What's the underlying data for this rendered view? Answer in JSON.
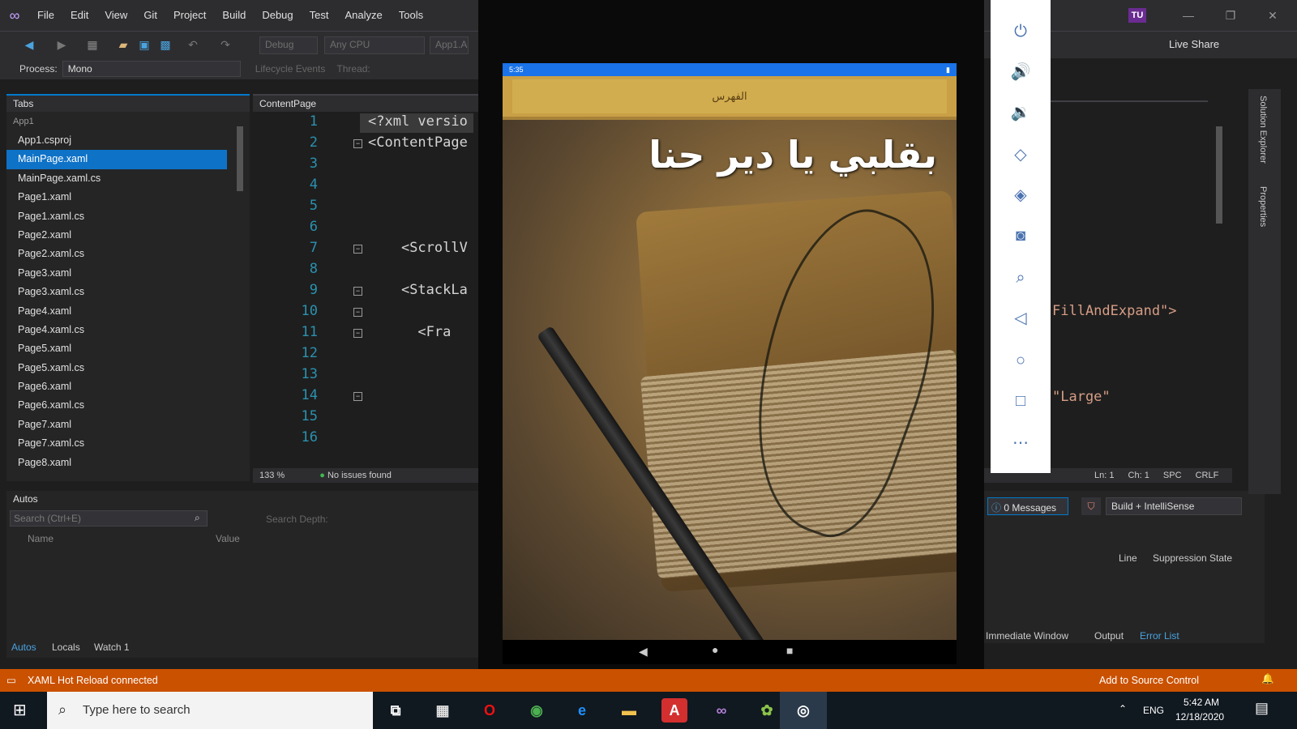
{
  "menu": {
    "items": [
      "File",
      "Edit",
      "View",
      "Git",
      "Project",
      "Build",
      "Debug",
      "Test",
      "Analyze",
      "Tools"
    ],
    "user_initials": "TU",
    "live_share": "Live Share"
  },
  "toolbar": {
    "config": "Debug",
    "platform": "Any CPU",
    "project_dd": "App1.A",
    "process_label": "Process:",
    "process_value": "Mono",
    "lifecycle": "Lifecycle Events",
    "thread": "Thread:"
  },
  "tabs_panel": {
    "title": "Tabs",
    "group": "App1",
    "files": [
      "App1.csproj",
      "MainPage.xaml",
      "MainPage.xaml.cs",
      "Page1.xaml",
      "Page1.xaml.cs",
      "Page2.xaml",
      "Page2.xaml.cs",
      "Page3.xaml",
      "Page3.xaml.cs",
      "Page4.xaml",
      "Page4.xaml.cs",
      "Page5.xaml",
      "Page5.xaml.cs",
      "Page6.xaml",
      "Page6.xaml.cs",
      "Page7.xaml",
      "Page7.xaml.cs",
      "Page8.xaml"
    ],
    "selected_index": 1
  },
  "code_panel": {
    "title": "ContentPage",
    "lines": [
      {
        "num": "1",
        "text": "<?xml versio"
      },
      {
        "num": "2",
        "text": "<ContentPage"
      },
      {
        "num": "3",
        "text": ""
      },
      {
        "num": "4",
        "text": ""
      },
      {
        "num": "5",
        "text": ""
      },
      {
        "num": "6",
        "text": ""
      },
      {
        "num": "7",
        "text": "    <ScrollV"
      },
      {
        "num": "8",
        "text": ""
      },
      {
        "num": "9",
        "text": "    <StackLa"
      },
      {
        "num": "10",
        "text": ""
      },
      {
        "num": "11",
        "text": "      <Fra"
      },
      {
        "num": "12",
        "text": ""
      },
      {
        "num": "13",
        "text": ""
      },
      {
        "num": "14",
        "text": ""
      },
      {
        "num": "15",
        "text": ""
      },
      {
        "num": "16",
        "text": ""
      }
    ],
    "zoom": "133 %",
    "issues": "No issues found"
  },
  "autos": {
    "title": "Autos",
    "search_placeholder": "Search (Ctrl+E)",
    "search_depth": "Search Depth:",
    "col_name": "Name",
    "col_value": "Value",
    "tabs": [
      "Autos",
      "Locals",
      "Watch 1"
    ]
  },
  "right_ide": {
    "code1": "FillAndExpand\">",
    "code2": "\"Large\"",
    "ln": "Ln: 1",
    "ch": "Ch: 1",
    "spc": "SPC",
    "crlf": "CRLF",
    "messages": "0 Messages",
    "build_filter": "Build + IntelliSense",
    "col_line": "Line",
    "col_suppression": "Suppression State",
    "bottom_tabs": [
      "Immediate Window",
      "Output",
      "Error List"
    ],
    "side_tabs": [
      "Solution Explorer",
      "Properties"
    ]
  },
  "statusbar": {
    "hot_reload": "XAML Hot Reload connected",
    "source_control": "Add to Source Control"
  },
  "taskbar": {
    "search_placeholder": "Type here to search",
    "lang": "ENG",
    "time": "5:42 AM",
    "date": "12/18/2020"
  },
  "emulator": {
    "status_time": "5:35",
    "header_text": "الفهرس",
    "title_text": "بقلبي يا دير حنا",
    "controls": [
      "power-icon",
      "volume-up-icon",
      "volume-down-icon",
      "rotate-left-icon",
      "rotate-right-icon",
      "camera-icon",
      "zoom-icon",
      "back-icon",
      "home-icon",
      "overview-icon",
      "more-icon"
    ]
  },
  "colors": {
    "accent": "#007acc",
    "statusbar": "#ca5100",
    "selection": "#0e72c7",
    "app_header": "#c9a046"
  }
}
